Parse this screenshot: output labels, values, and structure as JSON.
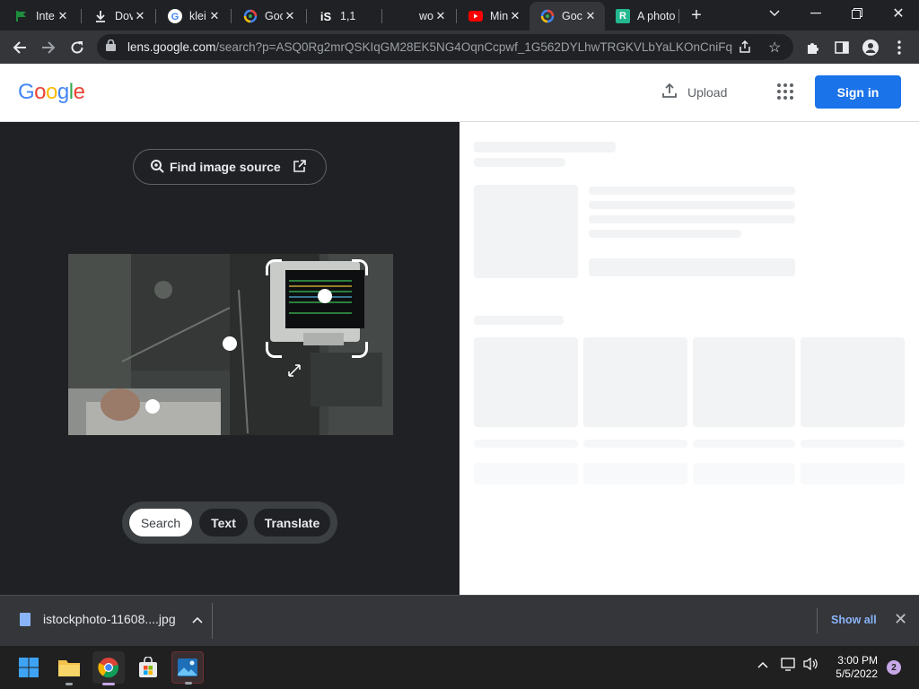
{
  "browser": {
    "tabs": [
      {
        "title": "Inte",
        "icon": "green-flag-icon"
      },
      {
        "title": "Dov",
        "icon": "download-icon"
      },
      {
        "title": "klei",
        "icon": "google-icon"
      },
      {
        "title": "Goc",
        "icon": "google-lens-icon"
      },
      {
        "title": "1,1",
        "icon": "istock-icon"
      },
      {
        "title": "wor",
        "icon": "blank-icon"
      },
      {
        "title": "Min",
        "icon": "youtube-icon"
      },
      {
        "title": "Goc",
        "icon": "google-lens-icon"
      },
      {
        "title": "A photo",
        "icon": "r-icon"
      }
    ],
    "active_tab_index": 7,
    "new_tab_label": "+",
    "url_domain": "lens.google.com",
    "url_path": "/search?p=ASQ0Rg2mrQSKIqGM28EK5NG4OqnCcpwf_1G562DYLhwTRGKVLbYaLKOnCniFq..."
  },
  "header": {
    "logo_letters": [
      "G",
      "o",
      "o",
      "g",
      "l",
      "e"
    ],
    "upload_label": "Upload",
    "signin_label": "Sign in"
  },
  "lens": {
    "find_source_label": "Find image source",
    "modes": [
      "Search",
      "Text",
      "Translate"
    ],
    "selected_mode": "Search"
  },
  "download": {
    "filename": "istockphoto-11608....jpg",
    "show_all_label": "Show all"
  },
  "taskbar": {
    "time": "3:00 PM",
    "date": "5/5/2022",
    "notification_count": "2"
  },
  "colors": {
    "accent_blue": "#1a73e8",
    "google_blue": "#4285f4",
    "google_red": "#ea4335",
    "google_yellow": "#fbbc05",
    "google_green": "#34a853"
  }
}
